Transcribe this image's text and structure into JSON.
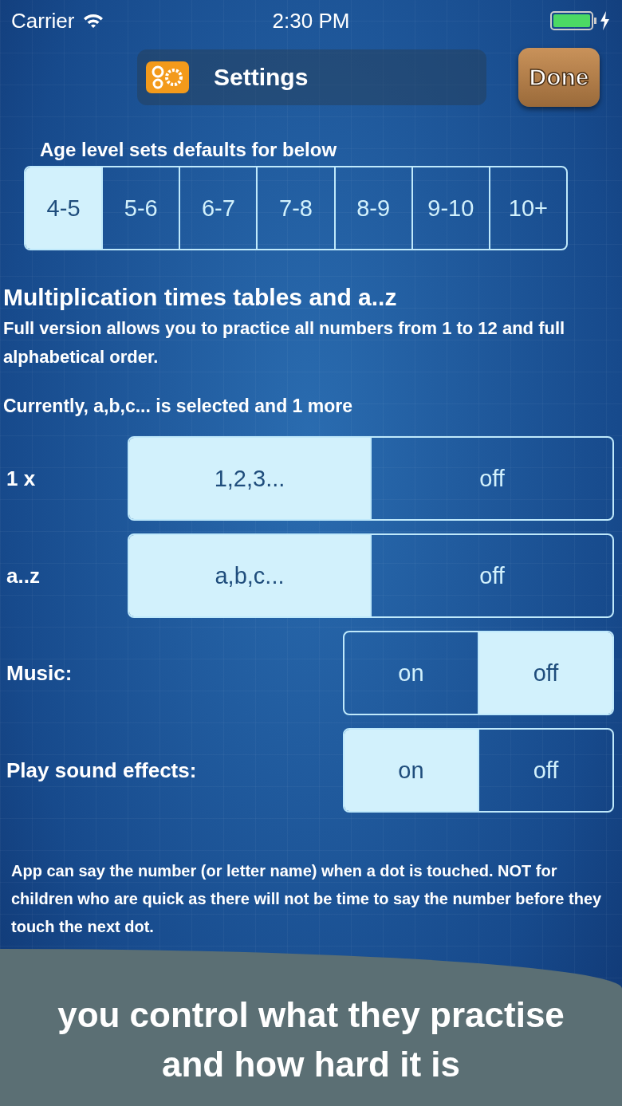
{
  "status_bar": {
    "carrier": "Carrier",
    "time": "2:30 PM"
  },
  "header": {
    "title": "Settings",
    "done_button": "Done"
  },
  "age_level": {
    "label": "Age level sets defaults for below",
    "options": [
      {
        "label": "4-5",
        "selected": true
      },
      {
        "label": "5-6",
        "selected": false
      },
      {
        "label": "6-7",
        "selected": false
      },
      {
        "label": "7-8",
        "selected": false
      },
      {
        "label": "8-9",
        "selected": false
      },
      {
        "label": "9-10",
        "selected": false
      },
      {
        "label": "10+",
        "selected": false
      }
    ]
  },
  "multiplication": {
    "title": "Multiplication times tables and a..z",
    "description": "Full version allows you to practice all numbers from 1 to 12 and full alphabetical order.",
    "current_selection": "Currently, a,b,c... is selected and 1 more"
  },
  "settings": [
    {
      "label": "1 x",
      "kind": "wide",
      "options": [
        {
          "label": "1,2,3...",
          "selected": true
        },
        {
          "label": "off",
          "selected": false
        }
      ]
    },
    {
      "label": "a..z",
      "kind": "wide",
      "options": [
        {
          "label": "a,b,c...",
          "selected": true
        },
        {
          "label": "off",
          "selected": false
        }
      ]
    },
    {
      "label": "Music:",
      "kind": "narrow",
      "options": [
        {
          "label": "on",
          "selected": false
        },
        {
          "label": "off",
          "selected": true
        }
      ]
    },
    {
      "label": "Play sound effects:",
      "kind": "narrow",
      "options": [
        {
          "label": "on",
          "selected": true
        },
        {
          "label": "off",
          "selected": false
        }
      ]
    }
  ],
  "note": "App can say the number (or letter name) when a dot is touched. NOT for children who are quick as there will not be time to say the number before they touch the next dot.",
  "caption": "you control what they practise and how hard it is"
}
